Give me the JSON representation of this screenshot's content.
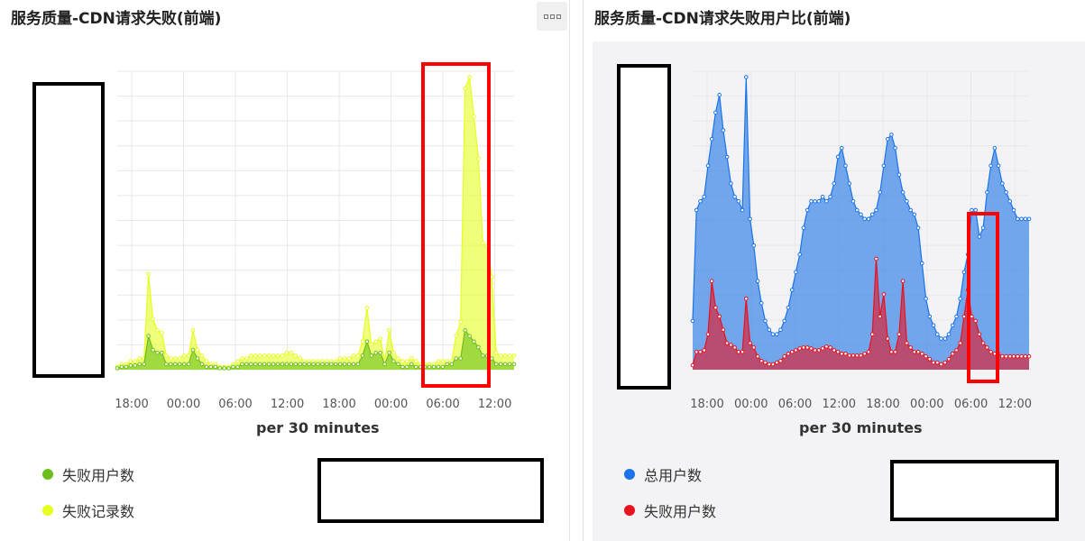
{
  "panels": [
    {
      "title": "服务质量-CDN请求失败(前端)",
      "xlabel": "per 30 minutes",
      "x_ticks": [
        "18:00",
        "00:00",
        "06:00",
        "12:00",
        "18:00",
        "00:00",
        "06:00",
        "12:00"
      ],
      "legend": [
        {
          "label": "失败用户数",
          "color": "#6cbf1a"
        },
        {
          "label": "失败记录数",
          "color": "#e6ff1f"
        }
      ]
    },
    {
      "title": "服务质量-CDN请求失败用户比(前端)",
      "xlabel": "per 30 minutes",
      "x_ticks": [
        "18:00",
        "00:00",
        "06:00",
        "12:00",
        "18:00",
        "00:00",
        "06:00",
        "12:00"
      ],
      "legend": [
        {
          "label": "总用户数",
          "color": "#1a73e8"
        },
        {
          "label": "失败用户数",
          "color": "#e8121e"
        }
      ]
    }
  ],
  "chart_data": [
    {
      "type": "area",
      "title": "服务质量-CDN请求失败(前端)",
      "xlabel": "per 30 minutes",
      "x_ticks": [
        "18:00",
        "00:00",
        "06:00",
        "12:00",
        "18:00",
        "00:00",
        "06:00",
        "12:00"
      ],
      "series": [
        {
          "name": "失败记录数",
          "color": "#e6ff1f",
          "values": [
            1,
            2,
            2,
            3,
            3,
            4,
            4,
            34,
            18,
            14,
            13,
            5,
            4,
            4,
            4,
            5,
            5,
            14,
            7,
            5,
            3,
            2,
            2,
            1,
            1,
            1,
            2,
            3,
            4,
            4,
            5,
            5,
            5,
            5,
            5,
            5,
            5,
            5,
            6,
            6,
            5,
            4,
            3,
            3,
            3,
            3,
            3,
            3,
            3,
            3,
            4,
            4,
            4,
            5,
            5,
            10,
            22,
            9,
            10,
            11,
            3,
            14,
            6,
            4,
            3,
            3,
            4,
            3,
            2,
            2,
            2,
            2,
            3,
            3,
            3,
            3,
            12,
            17,
            100,
            104,
            90,
            75,
            45,
            44,
            33,
            6,
            5,
            5,
            5,
            5
          ]
        },
        {
          "name": "失败用户数",
          "color": "#6cbf1a",
          "values": [
            0.5,
            1,
            1,
            1.5,
            1.5,
            2,
            2,
            12,
            7,
            6,
            6,
            2,
            2,
            2,
            2,
            2,
            2,
            7,
            4,
            2,
            1,
            1,
            1,
            0.5,
            0.5,
            0.5,
            1,
            1,
            2,
            2,
            2,
            2,
            2,
            2,
            2,
            2,
            2,
            2,
            2,
            2,
            2,
            2,
            2,
            2,
            2,
            2,
            2,
            2,
            2,
            2,
            2,
            2,
            2,
            2,
            2,
            5,
            10,
            5,
            6,
            6,
            2,
            6,
            3,
            2,
            1,
            1,
            2,
            1,
            1,
            1,
            1,
            1,
            1,
            1,
            2,
            2,
            4,
            4,
            14,
            12,
            10,
            8,
            5,
            5,
            4,
            2,
            2,
            2,
            2,
            2
          ]
        }
      ]
    },
    {
      "type": "area",
      "title": "服务质量-CDN请求失败用户比(前端)",
      "xlabel": "per 30 minutes",
      "x_ticks": [
        "18:00",
        "00:00",
        "06:00",
        "12:00",
        "18:00",
        "00:00",
        "06:00",
        "12:00"
      ],
      "series": [
        {
          "name": "总用户数",
          "color": "#1a73e8",
          "values": [
            55,
            180,
            190,
            195,
            230,
            260,
            290,
            310,
            270,
            240,
            210,
            195,
            190,
            180,
            330,
            170,
            140,
            100,
            75,
            55,
            45,
            40,
            40,
            45,
            55,
            70,
            90,
            110,
            130,
            160,
            180,
            190,
            190,
            190,
            195,
            190,
            195,
            210,
            240,
            250,
            230,
            210,
            190,
            180,
            175,
            170,
            170,
            175,
            180,
            200,
            230,
            260,
            265,
            250,
            220,
            200,
            190,
            180,
            175,
            160,
            120,
            80,
            60,
            50,
            40,
            35,
            35,
            40,
            50,
            60,
            80,
            110,
            130,
            180,
            180,
            150,
            160,
            200,
            230,
            250,
            230,
            210,
            200,
            190,
            180,
            170,
            170,
            170,
            170
          ]
        },
        {
          "name": "失败用户数",
          "color": "#e8121e",
          "values": [
            5,
            20,
            20,
            22,
            40,
            100,
            70,
            60,
            45,
            30,
            28,
            25,
            20,
            20,
            80,
            30,
            25,
            15,
            10,
            8,
            6,
            6,
            8,
            10,
            15,
            18,
            20,
            22,
            24,
            25,
            25,
            24,
            22,
            22,
            24,
            26,
            25,
            22,
            20,
            18,
            18,
            16,
            16,
            16,
            16,
            18,
            20,
            40,
            125,
            60,
            85,
            35,
            20,
            20,
            40,
            100,
            30,
            25,
            20,
            20,
            18,
            15,
            12,
            8,
            8,
            6,
            8,
            12,
            18,
            22,
            30,
            60,
            90,
            60,
            55,
            40,
            30,
            25,
            20,
            18,
            18,
            15,
            15,
            15,
            15,
            15,
            15,
            15,
            15
          ]
        }
      ]
    }
  ]
}
